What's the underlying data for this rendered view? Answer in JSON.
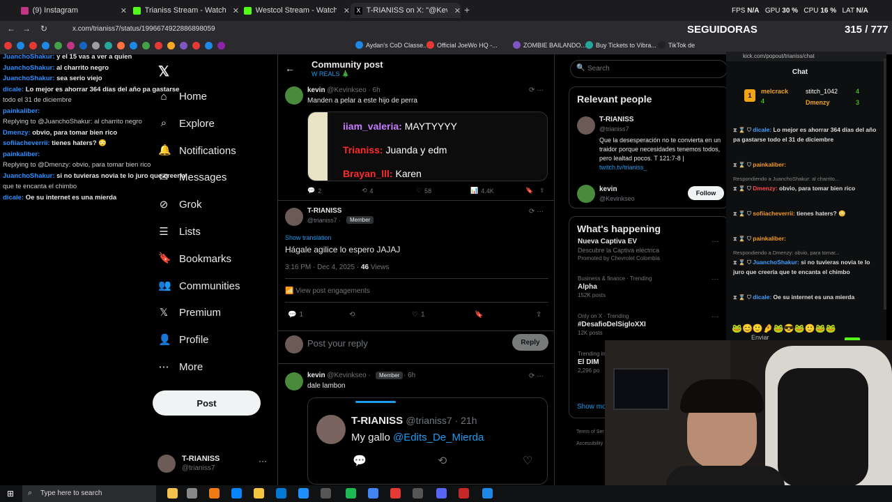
{
  "browser": {
    "tabs": [
      {
        "label": "(9) Instagram"
      },
      {
        "label": "Trianiss Stream - Watch Live on"
      },
      {
        "label": "Westcol Stream - Watch Live on"
      },
      {
        "label": "T-RIANISS on X: \"@Kevinkseo H"
      }
    ],
    "new_tab": "+",
    "url": "x.com/trianiss7/status/1996674922886898059",
    "bookmarks": [
      "Aydan's CoD Classe...",
      "Official JoeWo HQ -...",
      "ZOMBIE BAILANDO...",
      "Buy Tickets to Vibra...",
      "TikTok de"
    ]
  },
  "overlay_stats": {
    "fps_label": "FPS",
    "fps_value": "N/A",
    "gpu_label": "GPU",
    "gpu_value": "30 %",
    "cpu_label": "CPU",
    "cpu_value": "16 %",
    "lat_label": "LAT",
    "lat_value": "N/A"
  },
  "seguidoras": {
    "label": "SEGUIDORAS",
    "count": "315 / 777"
  },
  "overlay_chat": [
    {
      "user": "JuanchoShakur:",
      "text": " y el 15 vas a ver a quien"
    },
    {
      "user": "JuanchoShakur:",
      "text": " al charrito negro"
    },
    {
      "user": "JuanchoShakur:",
      "text": " sea serio viejo"
    },
    {
      "user": "dicale:",
      "text": " Lo mejor es ahorrar 364 días del año pa gastarse"
    },
    {
      "user": "",
      "text": "todo el 31 de diciembre"
    },
    {
      "user": "painkaliber:",
      "text": ""
    },
    {
      "user": "",
      "text": "Replying to @JuanchoShakur: al charrito negro"
    },
    {
      "user": "Dmenzy:",
      "text": " obvio, para tomar bien rico"
    },
    {
      "user": "sofiiacheverrii:",
      "text": " tienes haters? 😳"
    },
    {
      "user": "painkaliber:",
      "text": ""
    },
    {
      "user": "",
      "text": "Replying to @Dmenzy: obvio, para tomar bien rico"
    },
    {
      "user": "JuanchoShakur:",
      "text": " si no tuvieras novia te lo juro que creería"
    },
    {
      "user": "",
      "text": "que te encanta el chimbo"
    },
    {
      "user": "dicale:",
      "text": " Oe su internet es una mierda"
    }
  ],
  "nav": {
    "items": [
      {
        "label": "Home",
        "icon": "home-icon"
      },
      {
        "label": "Explore",
        "icon": "search-icon"
      },
      {
        "label": "Notifications",
        "icon": "bell-icon"
      },
      {
        "label": "Messages",
        "icon": "mail-icon"
      },
      {
        "label": "Grok",
        "icon": "grok-icon"
      },
      {
        "label": "Lists",
        "icon": "list-icon"
      },
      {
        "label": "Bookmarks",
        "icon": "bookmark-icon"
      },
      {
        "label": "Communities",
        "icon": "people-icon"
      },
      {
        "label": "Premium",
        "icon": "x-icon"
      },
      {
        "label": "Profile",
        "icon": "person-icon"
      },
      {
        "label": "More",
        "icon": "more-icon"
      }
    ],
    "post_button": "Post",
    "account": {
      "name": "T-RIANISS",
      "handle": "@trianiss7"
    }
  },
  "main": {
    "header_title": "Community post",
    "header_subtitle": "W REALS 🎄",
    "post1": {
      "name": "kevin",
      "handle": "@Kevinkseo · 6h",
      "text": "Manden a pelar a este hijo de perra",
      "embed_lines": [
        {
          "user": "iiam_valeria:",
          "text": " MAYTYYYY"
        },
        {
          "user": "Trianiss:",
          "text": " Juanda y edm"
        },
        {
          "user": "Brayan_lll:",
          "text": " Karen"
        }
      ],
      "replies": "2",
      "reposts": "4",
      "likes": "58",
      "views": "4.4K"
    },
    "post2": {
      "name": "T-RIANISS",
      "handle": "@trianiss7 ·",
      "badge": "Member",
      "show_translation": "Show translation",
      "text": "Hágale agilice lo espero JAJAJ",
      "timestamp": "3:16 PM · Dec 4, 2025 · ",
      "views_count": "46",
      "views_label": " Views",
      "engagements": "View post engagements",
      "replies": "1",
      "likes": "1"
    },
    "reply_box": {
      "placeholder": "Post your reply",
      "button": "Reply"
    },
    "post3": {
      "name": "kevin",
      "handle": "@Kevinkseo ·",
      "badge": "Member",
      "time": "· 6h",
      "text": "dale lambon",
      "quote_name": "T-RIANISS",
      "quote_handle": "@trianiss7 · 21h",
      "quote_text": "My gallo ",
      "quote_mention": "@Edits_De_Mierda"
    }
  },
  "right": {
    "search_placeholder": "Search",
    "relevant_title": "Relevant people",
    "person1": {
      "name": "T-RIANISS",
      "handle": "@trianiss7",
      "bio": "Que la desesperación no te convierta en un traidor porque necesidades tenemos todos, pero lealtad pocos. T 121:7-8 | ",
      "link": "twitch.tv/trianiss_"
    },
    "person2": {
      "name": "kevin",
      "handle": "@Kevinkseo",
      "follow": "Follow"
    },
    "happening_title": "What's happening",
    "trends": [
      {
        "title": "Nueva Captiva EV",
        "sub": "Descubre la Captiva eléctrica",
        "meta": "Promoted by Chevrolet Colombia"
      },
      {
        "meta": "Business & finance · Trending",
        "title": "Alpha",
        "sub": "152K posts"
      },
      {
        "meta": "Only on X · Trending",
        "title": "#DesafioDelSigloXXI",
        "sub": "12K posts"
      },
      {
        "meta": "Trending in",
        "title": "El DIM",
        "sub": "2,296 po"
      }
    ],
    "show_more": "Show mo",
    "footer": "Terms of Ser",
    "footer2": "Accessibility"
  },
  "kick": {
    "url": "kick.com/popout/trianiss/chat",
    "title": "Chat",
    "top": [
      {
        "rank": "1",
        "name": "melcrack",
        "count": "4"
      },
      {
        "name": "stitch_1042",
        "count": "4"
      },
      {
        "name": "Dmenzy",
        "count": "3"
      }
    ],
    "messages": [
      {
        "user": "dicale:",
        "text": " Lo mejor es ahorrar 364 días del año pa gastarse todo el 31 de diciembre",
        "color": "#3ea0ff"
      },
      {
        "user": "painkaliber:",
        "text": "",
        "color": "#f59a23"
      },
      {
        "user": "",
        "text": "Respondiendo a JuanchoShakur: al charrito...",
        "color": "#888"
      },
      {
        "user": "Dmenzy:",
        "text": " obvio, para tomar bien rico",
        "color": "#ff4b4b"
      },
      {
        "user": "sofiiacheverrii:",
        "text": " tienes haters? 😳",
        "color": "#f59a23"
      },
      {
        "user": "painkaliber:",
        "text": "",
        "color": "#f59a23"
      },
      {
        "user": "",
        "text": "Respondiendo a Dmenzy: obvio, para tomar...",
        "color": "#888"
      },
      {
        "user": "JuanchoShakur:",
        "text": " si no tuvieras novia te lo juro que creería que te encanta el chimbo",
        "color": "#3ea0ff"
      },
      {
        "user": "dicale:",
        "text": " Oe su internet es una mierda",
        "color": "#3ea0ff"
      }
    ],
    "send": "Enviar"
  },
  "taskbar": {
    "search": "Type here to search"
  },
  "colors": {
    "accent": "#1d9bf0",
    "kick_green": "#53fc18",
    "bg": "#000000"
  }
}
